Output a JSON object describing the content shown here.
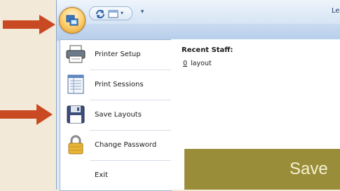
{
  "window": {
    "title_text": "Le"
  },
  "menu": {
    "items": [
      {
        "label": "Printer Setup",
        "icon": "printer-icon"
      },
      {
        "label": "Print Sessions",
        "icon": "sessions-list-icon"
      },
      {
        "label": "Save Layouts",
        "icon": "floppy-disk-icon"
      },
      {
        "label": "Change Password",
        "icon": "padlock-icon"
      },
      {
        "label": "Exit",
        "icon": ""
      }
    ]
  },
  "recent": {
    "title": "Recent Staff:",
    "items": [
      {
        "number": "0",
        "label": "layout"
      }
    ]
  },
  "slide": {
    "title": "Save"
  },
  "colors": {
    "arrow": "#c94a22",
    "slide_box": "#9a8d3a",
    "page_bg": "#f3e9d9"
  }
}
